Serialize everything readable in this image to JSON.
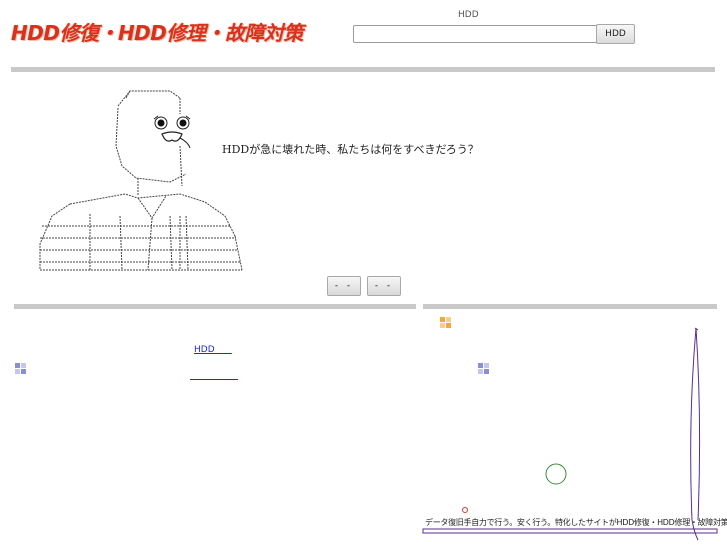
{
  "header": {
    "logo_text": "HDD修復・HDD修理・故障対策",
    "search_caption": "HDD",
    "search_value": "",
    "search_button_label": "HDD"
  },
  "hero": {
    "headline": "HDDが急に壊れた時、私たちは何をすべきだろう？",
    "prev_label": "- -",
    "next_label": "- -"
  },
  "left_panel": {
    "link_label": "HDD      "
  },
  "footer": {
    "tagline": "データ復旧手自力で行う。安く行う。特化したサイトがHDD修復・HDD修理・故障対策"
  },
  "colors": {
    "logo": "#d8311d",
    "link": "#1a2fd0",
    "bar": "#c9c9c9",
    "grid_blue": "#8a8ed6",
    "grid_orange": "#f2a640",
    "decor_purple": "#5a2d8c",
    "circle_green": "#3a8a3a"
  }
}
